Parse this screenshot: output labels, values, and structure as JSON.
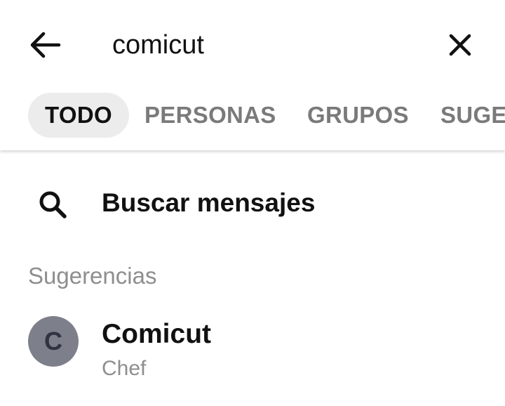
{
  "header": {
    "back_icon": "arrow-left-icon",
    "search_value": "comicut",
    "clear_icon": "close-icon"
  },
  "tabs": [
    {
      "label": "TODO",
      "active": true
    },
    {
      "label": "PERSONAS",
      "active": false
    },
    {
      "label": "GRUPOS",
      "active": false
    },
    {
      "label": "SUGE",
      "active": false
    }
  ],
  "search_messages": {
    "icon": "search-icon",
    "label": "Buscar mensajes"
  },
  "suggestions": {
    "title": "Sugerencias",
    "items": [
      {
        "avatar_letter": "C",
        "name": "Comicut",
        "subtitle": "Chef",
        "avatar_color": "#7d808a"
      }
    ]
  },
  "colors": {
    "active_tab_bg": "#ececec",
    "inactive_tab_text": "#7a7a7a",
    "muted_text": "#8e8e8e"
  }
}
